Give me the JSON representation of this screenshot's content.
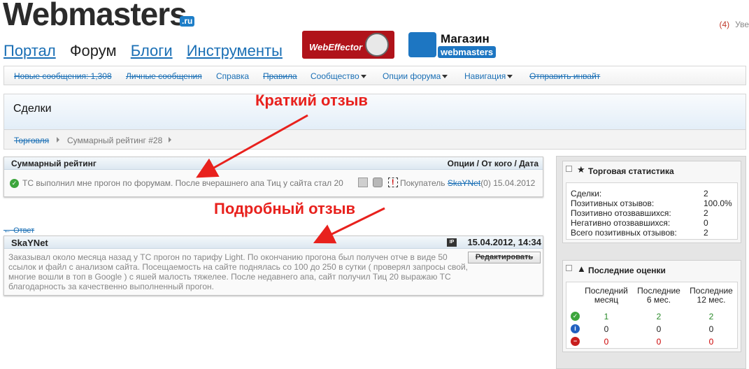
{
  "header": {
    "logo": "Webmasters",
    "logo_suffix": ".ru",
    "top_right_count": "(4)",
    "top_right_text": "Уве"
  },
  "main_nav": [
    "Портал",
    "Форум",
    "Блоги",
    "Инструменты"
  ],
  "banners": {
    "webeffector": "WebEffector",
    "shop_title": "Магазин",
    "shop_sub": "webmasters"
  },
  "sub_nav": [
    "Новые сообщения: 1,308",
    "Личные сообщения",
    "Справка",
    "Правила",
    "Сообщество",
    "Опции форума",
    "Навигация",
    "Отправить инвайт"
  ],
  "page_title": "Сделки",
  "breadcrumb": [
    "Торговля",
    "Суммарный рейтинг #28"
  ],
  "annotations": {
    "short": "Краткий отзыв",
    "detailed": "Подробный отзыв"
  },
  "summary_box": {
    "title": "Суммарный рейтинг",
    "header_right": "Опции / От кого / Дата",
    "review_text": "ТС выполнил мне прогон по форумам. После вчерашнего апа Тиц у сайта стал 20",
    "buyer_label": "Покупатель",
    "buyer_name": "SkaYNet",
    "buyer_score": "(0)",
    "date": "15.04.2012"
  },
  "reply_link": "Ответ",
  "detail_box": {
    "author": "SkaYNet",
    "ip_icon": "IP",
    "datetime": "15.04.2012, 14:34",
    "edit_button": "Редактировать",
    "body": "Заказывал около месяца назад у ТС прогон по тарифу Light. По окончанию прогона был получен отче в виде 50 ссылок и файл с анализом сайта. Посещаемость на сайте поднялась со 100 до 250 в сутки ( проверял запросы свой, многие вошли в топ в Google ) с яшей малость тяжелее. После недавнего апа, сайт получил Тиц 20 выражаю ТС благодарность за качественно выполненный прогон."
  },
  "trade_stats": {
    "title": "Торговая статистика",
    "rows": [
      {
        "label": "Сделки:",
        "value": "2"
      },
      {
        "label": "Позитивных отзывов:",
        "value": "100.0%"
      },
      {
        "label": "Позитивно отозвавшихся:",
        "value": "2"
      },
      {
        "label": "Негативно отозвавшихся:",
        "value": "0"
      },
      {
        "label": "Всего позитивных отзывов:",
        "value": "2"
      }
    ]
  },
  "last_ratings": {
    "title": "Последние оценки",
    "columns": [
      "Последний месяц",
      "Последние 6 мес.",
      "Последние 12 мес."
    ],
    "rows": [
      {
        "type": "positive",
        "values": [
          "1",
          "2",
          "2"
        ],
        "color": "#2a8a2a"
      },
      {
        "type": "neutral",
        "values": [
          "0",
          "0",
          "0"
        ],
        "color": "#222222"
      },
      {
        "type": "negative",
        "values": [
          "0",
          "0",
          "0"
        ],
        "color": "#cc0000"
      }
    ]
  }
}
